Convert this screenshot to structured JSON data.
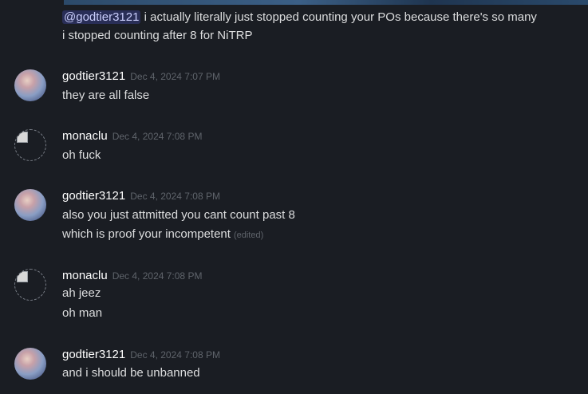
{
  "first_message": {
    "mention": "@godtier3121",
    "text": " i actually literally just stopped counting your POs because there's so many",
    "line2": "i stopped counting after 8 for NiTRP"
  },
  "messages": [
    {
      "username": "godtier3121",
      "timestamp": "Dec 4, 2024 7:07 PM",
      "lines": [
        "they are all false"
      ]
    },
    {
      "username": "monaclu",
      "timestamp": "Dec 4, 2024 7:08 PM",
      "lines": [
        "oh fuck"
      ]
    },
    {
      "username": "godtier3121",
      "timestamp": "Dec 4, 2024 7:08 PM",
      "lines": [
        "also you just attmitted you cant count past 8",
        "which is proof your incompetent"
      ],
      "edited": "(edited)"
    },
    {
      "username": "monaclu",
      "timestamp": "Dec 4, 2024 7:08 PM",
      "lines": [
        "ah jeez",
        "oh man"
      ]
    },
    {
      "username": "godtier3121",
      "timestamp": "Dec 4, 2024 7:08 PM",
      "lines": [
        "and i should be unbanned"
      ]
    }
  ],
  "colors": {
    "background": "#1a1d23",
    "mention_bg": "#3a3f6b",
    "username": "#ffffff",
    "timestamp": "#5f646b"
  }
}
